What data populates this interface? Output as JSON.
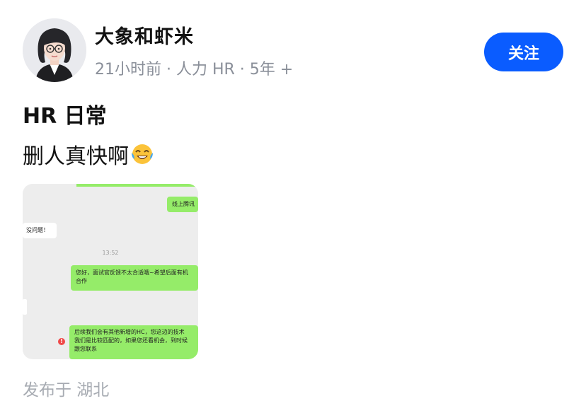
{
  "author": {
    "name": "大象和虾米",
    "meta": "21小时前 · 人力 HR · 5年 +"
  },
  "follow_label": "关注",
  "post": {
    "title": "HR 日常",
    "body": "删人真快啊"
  },
  "thumbnail": {
    "msg_top": "线上腾讯",
    "msg_left": "没问题！",
    "timestamp": "13:52",
    "msg_2_l1": "您好，面试官反馈不太合适哦~希望后面有机",
    "msg_2_l2": "合作",
    "msg_3_l1": "后续我们会有其他新增的HC，您这边的技术",
    "msg_3_l2": "我们是比较匹配的，如果您还看机会，到时候",
    "msg_3_l3": "跟您联系",
    "error_mark": "!"
  },
  "location": "发布于 湖北",
  "colors": {
    "accent": "#0a5cff",
    "chat_green": "#95ec69",
    "muted": "#8a8f99"
  }
}
